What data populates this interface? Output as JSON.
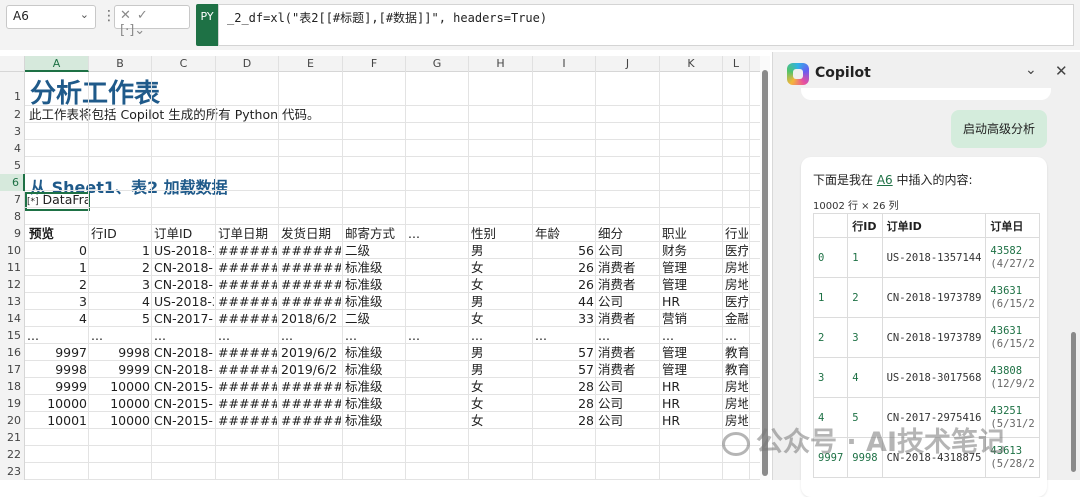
{
  "formula_bar": {
    "name_box": "A6",
    "py_badge": "PY",
    "formula": "_2_df=xl(\"表2[[#标题],[#数据]]\", headers=True)"
  },
  "columns": [
    "A",
    "B",
    "C",
    "D",
    "E",
    "F",
    "G",
    "H",
    "I",
    "J",
    "K",
    "L"
  ],
  "selected_column": "A",
  "rows": [
    "1",
    "2",
    "3",
    "4",
    "5",
    "6",
    "7",
    "8",
    "9",
    "10",
    "11",
    "12",
    "13",
    "14",
    "15",
    "16",
    "17",
    "18",
    "19",
    "20",
    "21",
    "22",
    "23"
  ],
  "selected_row": "6",
  "sheet": {
    "title": "分析工作表",
    "subtitle": "此工作表将包括 Copilot 生成的所有 Python 代码。",
    "section_heading": "从 Sheet1、表2 加载数据",
    "dataframe_label": "DataFrame",
    "dataframe_icon": "[*]",
    "preview_label": "预览",
    "header_row": [
      "",
      "行ID",
      "订单ID",
      "订单日期",
      "发货日期",
      "邮寄方式",
      "...",
      "性别",
      "年龄",
      "细分",
      "职业",
      "行业"
    ],
    "data_rows": [
      [
        "0",
        "1",
        "US-2018-1",
        "#######",
        "#######",
        "二级",
        "",
        "男",
        "56",
        "公司",
        "财务",
        "医疗"
      ],
      [
        "1",
        "2",
        "CN-2018-",
        "#######",
        "#######",
        "标准级",
        "",
        "女",
        "26",
        "消费者",
        "管理",
        "房地"
      ],
      [
        "2",
        "3",
        "CN-2018-",
        "#######",
        "#######",
        "标准级",
        "",
        "女",
        "26",
        "消费者",
        "管理",
        "房地"
      ],
      [
        "3",
        "4",
        "US-2018-3",
        "#######",
        "#######",
        "标准级",
        "",
        "男",
        "44",
        "公司",
        "HR",
        "医疗"
      ],
      [
        "4",
        "5",
        "CN-2017-",
        "#######",
        "2018/6/2",
        "二级",
        "",
        "女",
        "33",
        "消费者",
        "营销",
        "金融"
      ],
      [
        "...",
        "...",
        "...",
        "...",
        "...",
        "...",
        "...",
        "...",
        "...",
        "...",
        "...",
        "..."
      ],
      [
        "9997",
        "9998",
        "CN-2018-",
        "#######",
        "2019/6/2",
        "标准级",
        "",
        "男",
        "57",
        "消费者",
        "管理",
        "教育"
      ],
      [
        "9998",
        "9999",
        "CN-2018-",
        "#######",
        "2019/6/2",
        "标准级",
        "",
        "男",
        "57",
        "消费者",
        "管理",
        "教育"
      ],
      [
        "9999",
        "10000",
        "CN-2015-",
        "#######",
        "#######",
        "标准级",
        "",
        "女",
        "28",
        "公司",
        "HR",
        "房地"
      ],
      [
        "10000",
        "10000",
        "CN-2015-",
        "#######",
        "#######",
        "标准级",
        "",
        "女",
        "28",
        "公司",
        "HR",
        "房地"
      ],
      [
        "10001",
        "10000",
        "CN-2015-",
        "#######",
        "#######",
        "标准级",
        "",
        "女",
        "28",
        "公司",
        "HR",
        "房地"
      ]
    ]
  },
  "copilot": {
    "title": "Copilot",
    "user_message": "启动高级分析",
    "reply_intro_before": "下面是我在 ",
    "reply_intro_link": "A6",
    "reply_intro_after": " 中插入的内容:",
    "dims": "10002 行 × 26 列",
    "table_headers": [
      "",
      "行ID",
      "订单ID",
      "订单日"
    ],
    "table_rows": [
      [
        "0",
        "1",
        "US-2018-1357144",
        "43582",
        "(4/27/2"
      ],
      [
        "1",
        "2",
        "CN-2018-1973789",
        "43631",
        "(6/15/2"
      ],
      [
        "2",
        "3",
        "CN-2018-1973789",
        "43631",
        "(6/15/2"
      ],
      [
        "3",
        "4",
        "US-2018-3017568",
        "43808",
        "(12/9/2"
      ],
      [
        "4",
        "5",
        "CN-2017-2975416",
        "43251",
        "(5/31/2"
      ],
      [
        "9997",
        "9998",
        "CN-2018-4318875",
        "43613",
        "(5/28/2"
      ]
    ]
  },
  "watermark": "公众号 · AI技术笔记",
  "colors": {
    "accent": "#1e7145",
    "heading": "#1f5a8a",
    "user_bubble": "#d4ecdc"
  }
}
